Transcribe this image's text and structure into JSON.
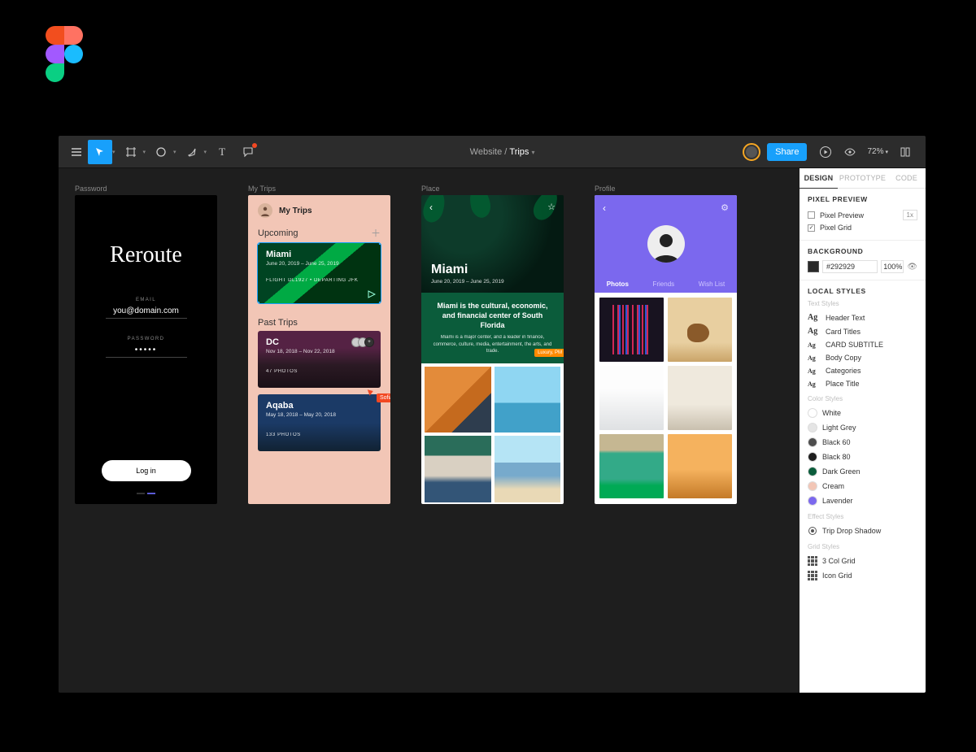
{
  "toolbar": {
    "share": "Share",
    "zoom": "72%"
  },
  "breadcrumb": {
    "project": "Website",
    "page": "Trips"
  },
  "artboards": {
    "password": {
      "label": "Password",
      "brand": "Reroute",
      "email_label": "EMAIL",
      "email_value": "you@domain.com",
      "password_label": "PASSWORD",
      "password_value": "•••••",
      "login": "Log in"
    },
    "mytrips": {
      "label": "My Trips",
      "title": "My Trips",
      "upcoming": "Upcoming",
      "past": "Past Trips",
      "cards": [
        {
          "title": "Miami",
          "dates": "June 20, 2019 – June 25, 2019",
          "sub": "FLIGHT DL1927 • DEPARTING JFK"
        },
        {
          "title": "DC",
          "dates": "Nov 18, 2018 – Nov 22, 2018",
          "sub": "47 PHOTOS"
        },
        {
          "title": "Aqaba",
          "dates": "May 18, 2018 – May 20, 2018",
          "sub": "133 PHOTOS"
        }
      ],
      "cursor_user": "Sofia, Engineer"
    },
    "place": {
      "label": "Place",
      "title": "Miami",
      "dates": "June 20, 2019 – June 25, 2019",
      "headline": "Miami is the cultural, economic, and financial center of South Florida",
      "body": "Miami is a major center, and a leader in finance, commerce, culture, media, entertainment, the arts, and trade.",
      "chip": "Luxury, PM"
    },
    "profile": {
      "label": "Profile",
      "tabs": [
        "Photos",
        "Friends",
        "Wish List"
      ]
    }
  },
  "rpanel": {
    "tabs": [
      "DESIGN",
      "PROTOTYPE",
      "CODE"
    ],
    "pixel_preview": {
      "title": "PIXEL PREVIEW",
      "preview": "Pixel Preview",
      "grid": "Pixel Grid",
      "scale": "1x"
    },
    "background": {
      "title": "BACKGROUND",
      "hex": "#292929",
      "opacity": "100%"
    },
    "local_styles": "LOCAL STYLES",
    "text_styles_label": "Text Styles",
    "text_styles": [
      "Header Text",
      "Card Titles",
      "CARD SUBTITLE",
      "Body Copy",
      "Categories",
      "Place Title"
    ],
    "color_styles_label": "Color Styles",
    "color_styles": [
      {
        "name": "White",
        "hex": "#ffffff"
      },
      {
        "name": "Light Grey",
        "hex": "#e5e5e5"
      },
      {
        "name": "Black 60",
        "hex": "#4d4d4d"
      },
      {
        "name": "Black 80",
        "hex": "#1e1e1e"
      },
      {
        "name": "Dark Green",
        "hex": "#0b5c3b"
      },
      {
        "name": "Cream",
        "hex": "#f2c6b6"
      },
      {
        "name": "Lavender",
        "hex": "#7b68ee"
      }
    ],
    "effect_styles_label": "Effect Styles",
    "effect_styles": [
      "Trip Drop Shadow"
    ],
    "grid_styles_label": "Grid Styles",
    "grid_styles": [
      "3 Col Grid",
      "Icon Grid"
    ]
  }
}
